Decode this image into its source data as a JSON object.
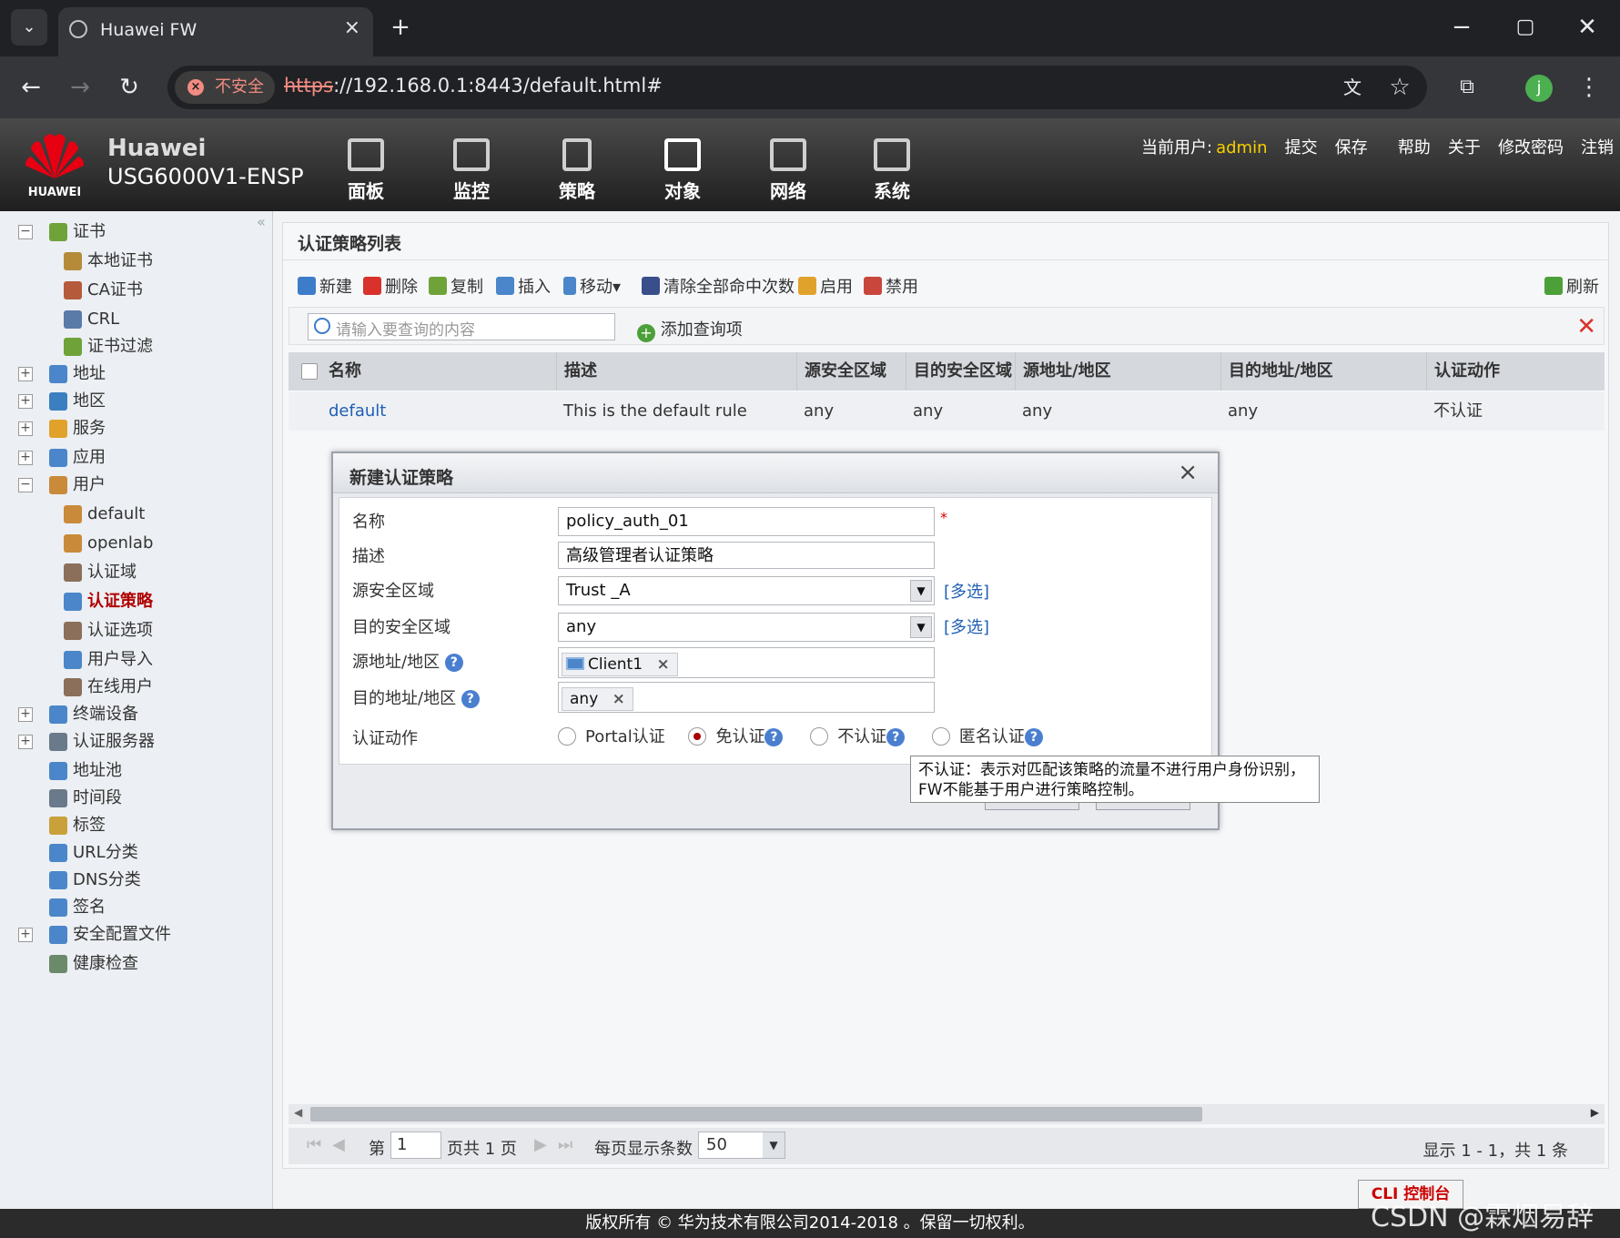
{
  "browser": {
    "tab_title": "Huawei FW",
    "security_label": "不安全",
    "url_scheme": "https",
    "url_rest": "://192.168.0.1:8443/default.html#",
    "profile_initial": "j"
  },
  "header": {
    "brand": "Huawei",
    "brand_small": "HUAWEI",
    "model": "USG6000V1-ENSP",
    "nav": [
      "面板",
      "监控",
      "策略",
      "对象",
      "网络",
      "系统"
    ],
    "current_user_label": "当前用户:",
    "current_user": "admin",
    "links": [
      "提交",
      "保存",
      "帮助",
      "关于",
      "修改密码",
      "注销"
    ]
  },
  "sidebar": {
    "items": [
      {
        "label": "证书",
        "toggle": "−"
      },
      {
        "label": "本地证书"
      },
      {
        "label": "CA证书"
      },
      {
        "label": "CRL"
      },
      {
        "label": "证书过滤"
      },
      {
        "label": "地址",
        "toggle": "+"
      },
      {
        "label": "地区",
        "toggle": "+"
      },
      {
        "label": "服务",
        "toggle": "+"
      },
      {
        "label": "应用",
        "toggle": "+"
      },
      {
        "label": "用户",
        "toggle": "−"
      },
      {
        "label": "default"
      },
      {
        "label": "openlab"
      },
      {
        "label": "认证域"
      },
      {
        "label": "认证策略"
      },
      {
        "label": "认证选项"
      },
      {
        "label": "用户导入"
      },
      {
        "label": "在线用户"
      },
      {
        "label": "终端设备",
        "toggle": "+"
      },
      {
        "label": "认证服务器",
        "toggle": "+"
      },
      {
        "label": "地址池"
      },
      {
        "label": "时间段"
      },
      {
        "label": "标签"
      },
      {
        "label": "URL分类"
      },
      {
        "label": "DNS分类"
      },
      {
        "label": "签名"
      },
      {
        "label": "安全配置文件",
        "toggle": "+"
      },
      {
        "label": "健康检查"
      }
    ]
  },
  "panel": {
    "title": "认证策略列表",
    "toolbar": [
      "新建",
      "删除",
      "复制",
      "插入",
      "移动▾",
      "清除全部命中次数",
      "启用",
      "禁用"
    ],
    "refresh": "刷新",
    "search_placeholder": "请输入要查询的内容",
    "add_query": "添加查询项",
    "columns": [
      "名称",
      "描述",
      "源安全区域",
      "目的安全区域",
      "源地址/地区",
      "目的地址/地区",
      "认证动作"
    ],
    "rows": [
      [
        "default",
        "This is the default rule",
        "any",
        "any",
        "any",
        "any",
        "不认证"
      ]
    ],
    "pager": {
      "page_prefix": "第",
      "page": "1",
      "page_suffix": "页共 1 页",
      "per_page_label": "每页显示条数",
      "per_page": "50",
      "summary": "显示 1 - 1，共 1 条"
    }
  },
  "dialog": {
    "title": "新建认证策略",
    "close": "×",
    "labels": [
      "名称",
      "描述",
      "源安全区域",
      "目的安全区域",
      "源地址/地区",
      "目的地址/地区",
      "认证动作"
    ],
    "name_value": "policy_auth_01",
    "required_mark": "*",
    "desc_value": "高级管理者认证策略",
    "src_zone": "Trust _A",
    "dst_zone": "any",
    "multi_select": "[多选]",
    "src_addr_tag": "Client1",
    "dst_addr_tag": "any",
    "tag_remove": "×",
    "help_mark": "?",
    "radio_options": [
      "Portal认证",
      "免认证",
      "不认证",
      "匿名认证"
    ],
    "selected_radio": "免认证",
    "tooltip": "不认证：表示对匹配该策略的流量不进行用户身份识别，FW不能基于用户进行策略控制。"
  },
  "cli_button": "CLI 控制台",
  "watermark": "CSDN @霖烟易辞",
  "footer": "版权所有 © 华为技术有限公司2014-2018 。保留一切权利。"
}
